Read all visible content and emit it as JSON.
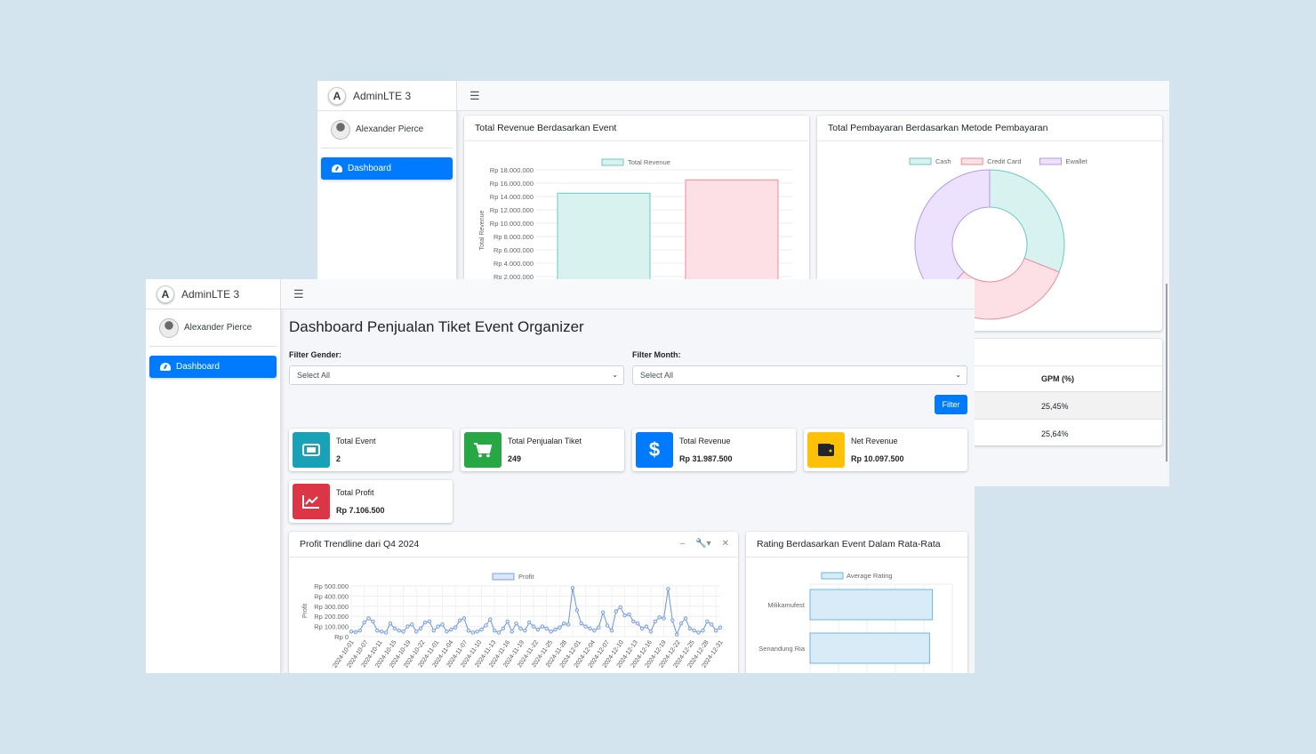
{
  "brand": "AdminLTE 3",
  "user": "Alexander Pierce",
  "nav_dashboard": "Dashboard",
  "menu_icon": "☰",
  "back": {
    "revenue_card_title": "Total Revenue Berdasarkan Event",
    "payment_card_title": "Total Pembayaran Berdasarkan Metode Pembayaran",
    "table_header_gpm": "GPM (%)",
    "table_rows": [
      "25,45%",
      "25,64%"
    ]
  },
  "front": {
    "page_title": "Dashboard Penjualan Tiket Event Organizer",
    "filter_gender_label": "Filter Gender:",
    "filter_gender_value": "Select All",
    "filter_month_label": "Filter Month:",
    "filter_month_value": "Select All",
    "filter_button": "Filter",
    "info_boxes": [
      {
        "title": "Total Event",
        "value": "2",
        "color": "#17a2b8",
        "icon": "ticket-icon"
      },
      {
        "title": "Total Penjualan Tiket",
        "value": "249",
        "color": "#28a745",
        "icon": "cart-icon"
      },
      {
        "title": "Total Revenue",
        "value": "Rp 31.987.500",
        "color": "#007bff",
        "icon": "dollar-icon"
      },
      {
        "title": "Net Revenue",
        "value": "Rp 10.097.500",
        "color": "#ffc107",
        "icon": "wallet-icon"
      },
      {
        "title": "Total Profit",
        "value": "Rp 7.106.500",
        "color": "#dc3545",
        "icon": "chart-line-icon"
      }
    ],
    "profit_card_title": "Profit Trendline dari Q4 2024",
    "rating_card_title": "Rating Berdasarkan Event Dalam Rata-Rata",
    "tool_minus": "–",
    "tool_wrench": "🔧▾",
    "tool_close": "✕"
  },
  "chart_data": [
    {
      "type": "bar",
      "title": "Total Revenue Berdasarkan Event",
      "ylabel": "Total Revenue",
      "legend": "top",
      "series": [
        {
          "name": "Total Revenue",
          "values": [
            14500000,
            16500000
          ]
        }
      ],
      "colors": [
        "#d8f2f0",
        "#fde0e6"
      ],
      "borders": [
        "#6cc8c2",
        "#f08aa0"
      ],
      "yticks": [
        "Rp 18.000.000",
        "Rp 16.000.000",
        "Rp 14.000.000",
        "Rp 12.000.000",
        "Rp 10.000.000",
        "Rp 8.000.000",
        "Rp 6.000.000",
        "Rp 4.000.000",
        "Rp 2.000.000"
      ],
      "ylim": [
        0,
        18000000
      ]
    },
    {
      "type": "pie",
      "title": "Total Pembayaran Berdasarkan Metode Pembayaran",
      "legend": "top",
      "labels": [
        "Cash",
        "Credit Card",
        "Ewallet"
      ],
      "values": [
        31,
        31,
        38
      ],
      "colors": [
        "#d8f2f0",
        "#fde0e6",
        "#ece2fd"
      ],
      "borders": [
        "#6cc8c2",
        "#f08aa0",
        "#b697f0"
      ]
    },
    {
      "type": "line",
      "title": "Profit Trendline dari Q4 2024",
      "ylabel": "Profit",
      "legend": "top",
      "series": [
        {
          "name": "Profit",
          "values": [
            50000,
            45000,
            60000,
            140000,
            180000,
            150000,
            60000,
            50000,
            40000,
            130000,
            80000,
            60000,
            50000,
            100000,
            120000,
            50000,
            80000,
            140000,
            150000,
            60000,
            100000,
            120000,
            50000,
            70000,
            90000,
            160000,
            180000,
            60000,
            40000,
            50000,
            70000,
            110000,
            170000,
            60000,
            40000,
            80000,
            150000,
            50000,
            130000,
            80000,
            60000,
            140000,
            100000,
            70000,
            100000,
            80000,
            50000,
            70000,
            90000,
            130000,
            120000,
            480000,
            260000,
            130000,
            100000,
            80000,
            60000,
            90000,
            240000,
            110000,
            60000,
            250000,
            290000,
            210000,
            220000,
            150000,
            130000,
            80000,
            100000,
            50000,
            150000,
            190000,
            180000,
            470000,
            160000,
            20000,
            130000,
            180000,
            80000,
            60000,
            40000,
            60000,
            150000,
            120000,
            60000,
            90000
          ]
        }
      ],
      "yticks": [
        "Rp 500.000",
        "Rp 400.000",
        "Rp 300.000",
        "Rp 200.000",
        "Rp 100.000",
        "Rp 0"
      ],
      "ylim": [
        0,
        500000
      ],
      "x": [
        "2024-10-01",
        "2024-10-07",
        "2024-10-11",
        "2024-10-15",
        "2024-10-19",
        "2024-10-22",
        "2024-11-01",
        "2024-11-04",
        "2024-11-07",
        "2024-11-10",
        "2024-11-13",
        "2024-11-16",
        "2024-11-19",
        "2024-11-22",
        "2024-11-25",
        "2024-11-28",
        "2024-12-01",
        "2024-12-04",
        "2024-12-07",
        "2024-12-10",
        "2024-12-13",
        "2024-12-16",
        "2024-12-19",
        "2024-12-22",
        "2024-12-25",
        "2024-12-28",
        "2024-12-31"
      ]
    },
    {
      "type": "bar",
      "orientation": "horizontal",
      "title": "Rating Berdasarkan Event Dalam Rata-Rata",
      "legend": "top",
      "categories": [
        "Milikamufest",
        "Senandung Ria"
      ],
      "series": [
        {
          "name": "Average Rating",
          "values": [
            4.3,
            4.2
          ]
        }
      ]
    }
  ]
}
